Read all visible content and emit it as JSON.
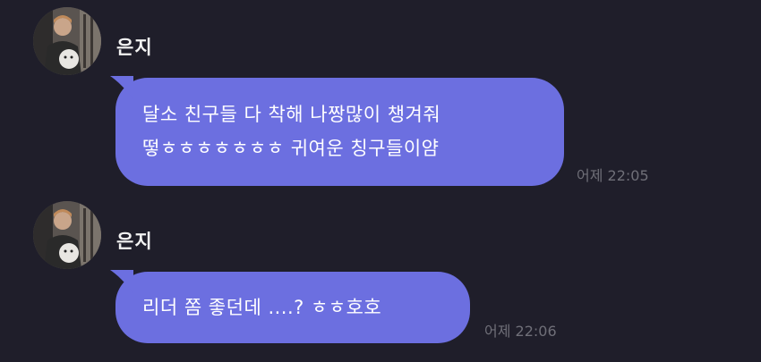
{
  "messages": [
    {
      "sender": "은지",
      "lines": [
        "달소 친구들 다 착해 나짱많이 챙겨줘",
        "떻ㅎㅎㅎㅎㅎㅎㅎ 귀여운 칭구들이얌"
      ],
      "time": "어제 22:05",
      "avatar_icon": "profile-photo"
    },
    {
      "sender": "은지",
      "lines": [
        "리더 쫌 좋던데 ....? ㅎㅎ호호"
      ],
      "time": "어제 22:06",
      "avatar_icon": "profile-photo"
    }
  ],
  "colors": {
    "background": "#1f1e2a",
    "bubble": "#6c6fe0",
    "text": "#ffffff",
    "timestamp": "#6f6f78"
  }
}
